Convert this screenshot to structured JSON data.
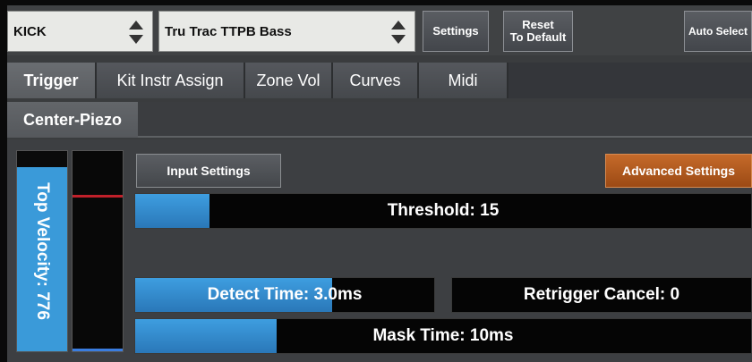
{
  "toolbar": {
    "instrument_select": "KICK",
    "trigger_select": "Tru Trac TTPB Bass",
    "settings_label": "Settings",
    "reset_label_line1": "Reset",
    "reset_label_line2": "To Default",
    "auto_select_label": "Auto Select"
  },
  "tabs": [
    {
      "label": "Trigger",
      "active": true
    },
    {
      "label": "Kit Instr Assign",
      "active": false
    },
    {
      "label": "Zone Vol",
      "active": false
    },
    {
      "label": "Curves",
      "active": false
    },
    {
      "label": "Midi",
      "active": false
    }
  ],
  "zone": {
    "label": "Center-Piezo"
  },
  "velocity": {
    "label": "Top Velocity: 776",
    "level_fraction": 0.92
  },
  "meter": {
    "peak_fraction": 0.77
  },
  "buttons": {
    "input_settings": "Input Settings",
    "advanced_settings": "Advanced Settings"
  },
  "sliders": {
    "threshold": {
      "label": "Threshold: 15",
      "fraction": 0.12
    },
    "detect_time": {
      "label": "Detect Time: 3.0ms",
      "fraction": 0.66
    },
    "retrigger_cancel": {
      "label": "Retrigger Cancel: 0",
      "fraction": 0.0
    },
    "mask_time": {
      "label": "Mask Time: 10ms",
      "fraction": 0.23
    }
  },
  "colors": {
    "accent_blue": "#3a9ad9",
    "advanced_orange": "#c56a2a",
    "peak_red": "#c0202a"
  }
}
